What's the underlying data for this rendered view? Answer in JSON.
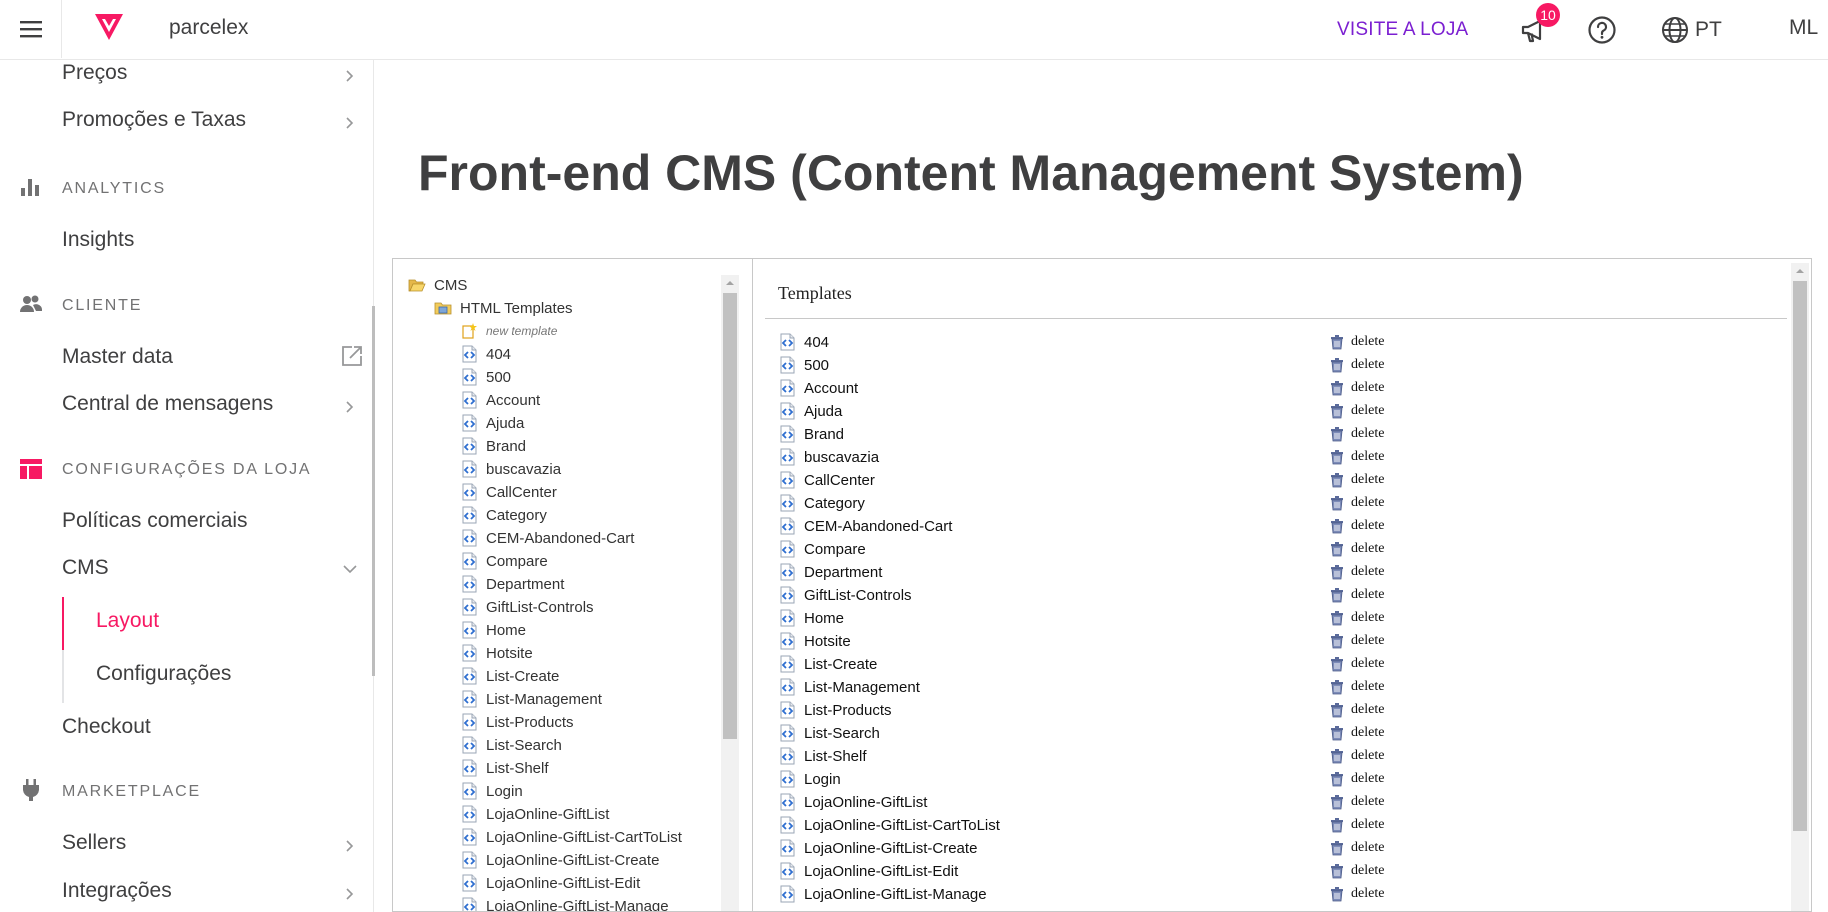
{
  "header": {
    "account_name": "parcelex",
    "visit_store": "VISITE A LOJA",
    "notification_count": "10",
    "language": "PT",
    "user_initials": "ML",
    "brand_color": "#f71963"
  },
  "sidebar": {
    "items_top": [
      {
        "label": "Preços"
      },
      {
        "label": "Promoções e Taxas"
      }
    ],
    "sections": {
      "analytics": {
        "title": "ANALYTICS",
        "items": [
          {
            "label": "Insights"
          }
        ]
      },
      "cliente": {
        "title": "CLIENTE",
        "items": [
          {
            "label": "Master data"
          },
          {
            "label": "Central de mensagens"
          }
        ]
      },
      "config": {
        "title": "CONFIGURAÇÕES DA LOJA",
        "items": [
          {
            "label": "Políticas comerciais"
          },
          {
            "label": "CMS"
          },
          {
            "label": "Checkout"
          }
        ]
      },
      "cms_sub": [
        {
          "label": "Layout"
        },
        {
          "label": "Configurações"
        }
      ],
      "marketplace": {
        "title": "MARKETPLACE",
        "items": [
          {
            "label": "Sellers"
          },
          {
            "label": "Integrações"
          }
        ]
      }
    }
  },
  "main": {
    "title": "Front-end CMS (Content Management System)"
  },
  "tree": {
    "root": "CMS",
    "folder": "HTML Templates",
    "new_template": "new template",
    "items": [
      "404",
      "500",
      "Account",
      "Ajuda",
      "Brand",
      "buscavazia",
      "CallCenter",
      "Category",
      "CEM-Abandoned-Cart",
      "Compare",
      "Department",
      "GiftList-Controls",
      "Home",
      "Hotsite",
      "List-Create",
      "List-Management",
      "List-Products",
      "List-Search",
      "List-Shelf",
      "Login",
      "LojaOnline-GiftList",
      "LojaOnline-GiftList-CartToList",
      "LojaOnline-GiftList-Create",
      "LojaOnline-GiftList-Edit",
      "LojaOnline-GiftList-Manage"
    ]
  },
  "templates": {
    "title": "Templates",
    "delete_label": "delete",
    "items": [
      "404",
      "500",
      "Account",
      "Ajuda",
      "Brand",
      "buscavazia",
      "CallCenter",
      "Category",
      "CEM-Abandoned-Cart",
      "Compare",
      "Department",
      "GiftList-Controls",
      "Home",
      "Hotsite",
      "List-Create",
      "List-Management",
      "List-Products",
      "List-Search",
      "List-Shelf",
      "Login",
      "LojaOnline-GiftList",
      "LojaOnline-GiftList-CartToList",
      "LojaOnline-GiftList-Create",
      "LojaOnline-GiftList-Edit",
      "LojaOnline-GiftList-Manage"
    ]
  }
}
